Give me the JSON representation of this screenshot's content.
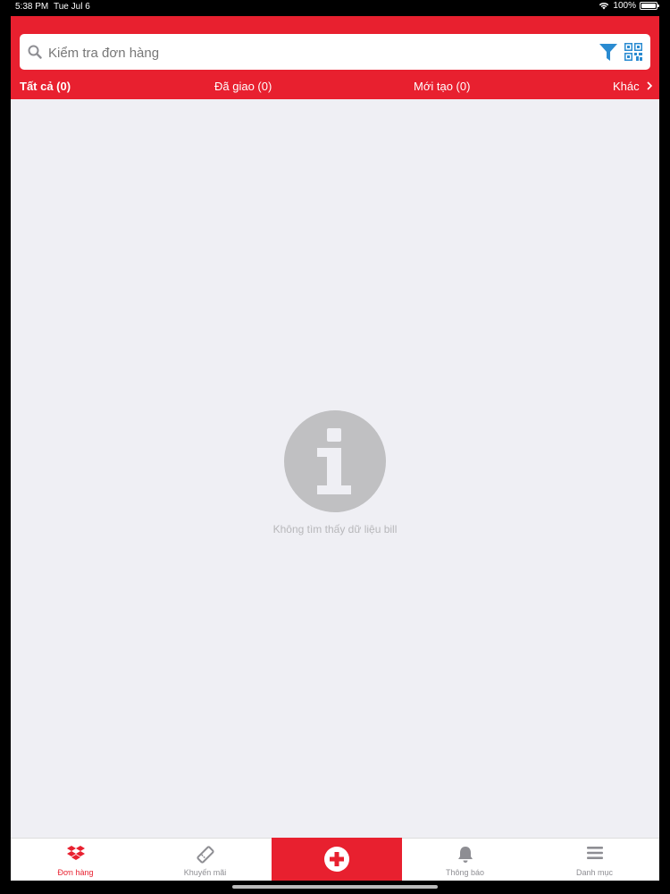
{
  "status_bar": {
    "time": "5:38 PM",
    "date": "Tue Jul 6",
    "battery": "100%"
  },
  "search": {
    "placeholder": "Kiểm tra đơn hàng"
  },
  "tabs": [
    {
      "label": "Tất cả (0)",
      "active": true
    },
    {
      "label": "Đã giao (0)",
      "active": false
    },
    {
      "label": "Mới tạo (0)",
      "active": false
    },
    {
      "label": "Khác",
      "active": false
    }
  ],
  "empty_state": {
    "message": "Không tìm thấy dữ liệu bill"
  },
  "bottom_nav": [
    {
      "label": "Đơn hàng",
      "icon": "box-icon",
      "active": true
    },
    {
      "label": "Khuyến mãi",
      "icon": "ticket-icon",
      "active": false
    },
    {
      "label": "",
      "icon": "plus-icon",
      "active": false
    },
    {
      "label": "Thông báo",
      "icon": "bell-icon",
      "active": false
    },
    {
      "label": "Danh mục",
      "icon": "menu-icon",
      "active": false
    }
  ],
  "colors": {
    "brand_red": "#e8202f",
    "accent_blue": "#2a8bd1",
    "background": "#efeff4"
  }
}
